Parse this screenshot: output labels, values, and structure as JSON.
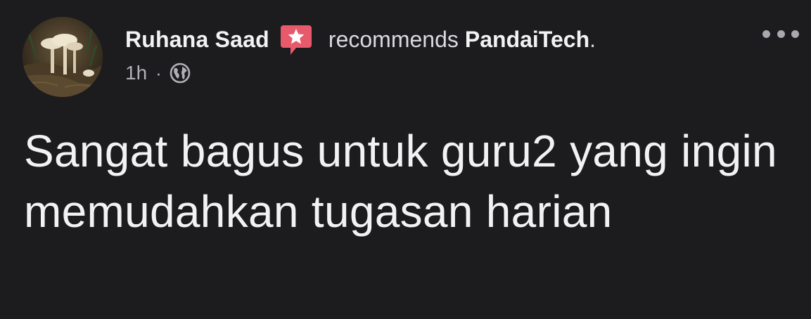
{
  "post": {
    "author_name": "Ruhana Saad",
    "action_text": "recommends",
    "page_name": "PandaiTech",
    "period": ".",
    "timestamp": "1h",
    "separator": "·",
    "content_text": "Sangat bagus untuk guru2 yang ingin memudahkan tugasan harian"
  },
  "icons": {
    "recommendation": "recommend-star-icon",
    "privacy": "globe-icon",
    "more": "more-options-icon"
  },
  "colors": {
    "background": "#1c1c1e",
    "primary_text": "#f2f2f4",
    "secondary_text": "#b0b0b6",
    "recommend_badge": "#e85a6b"
  }
}
